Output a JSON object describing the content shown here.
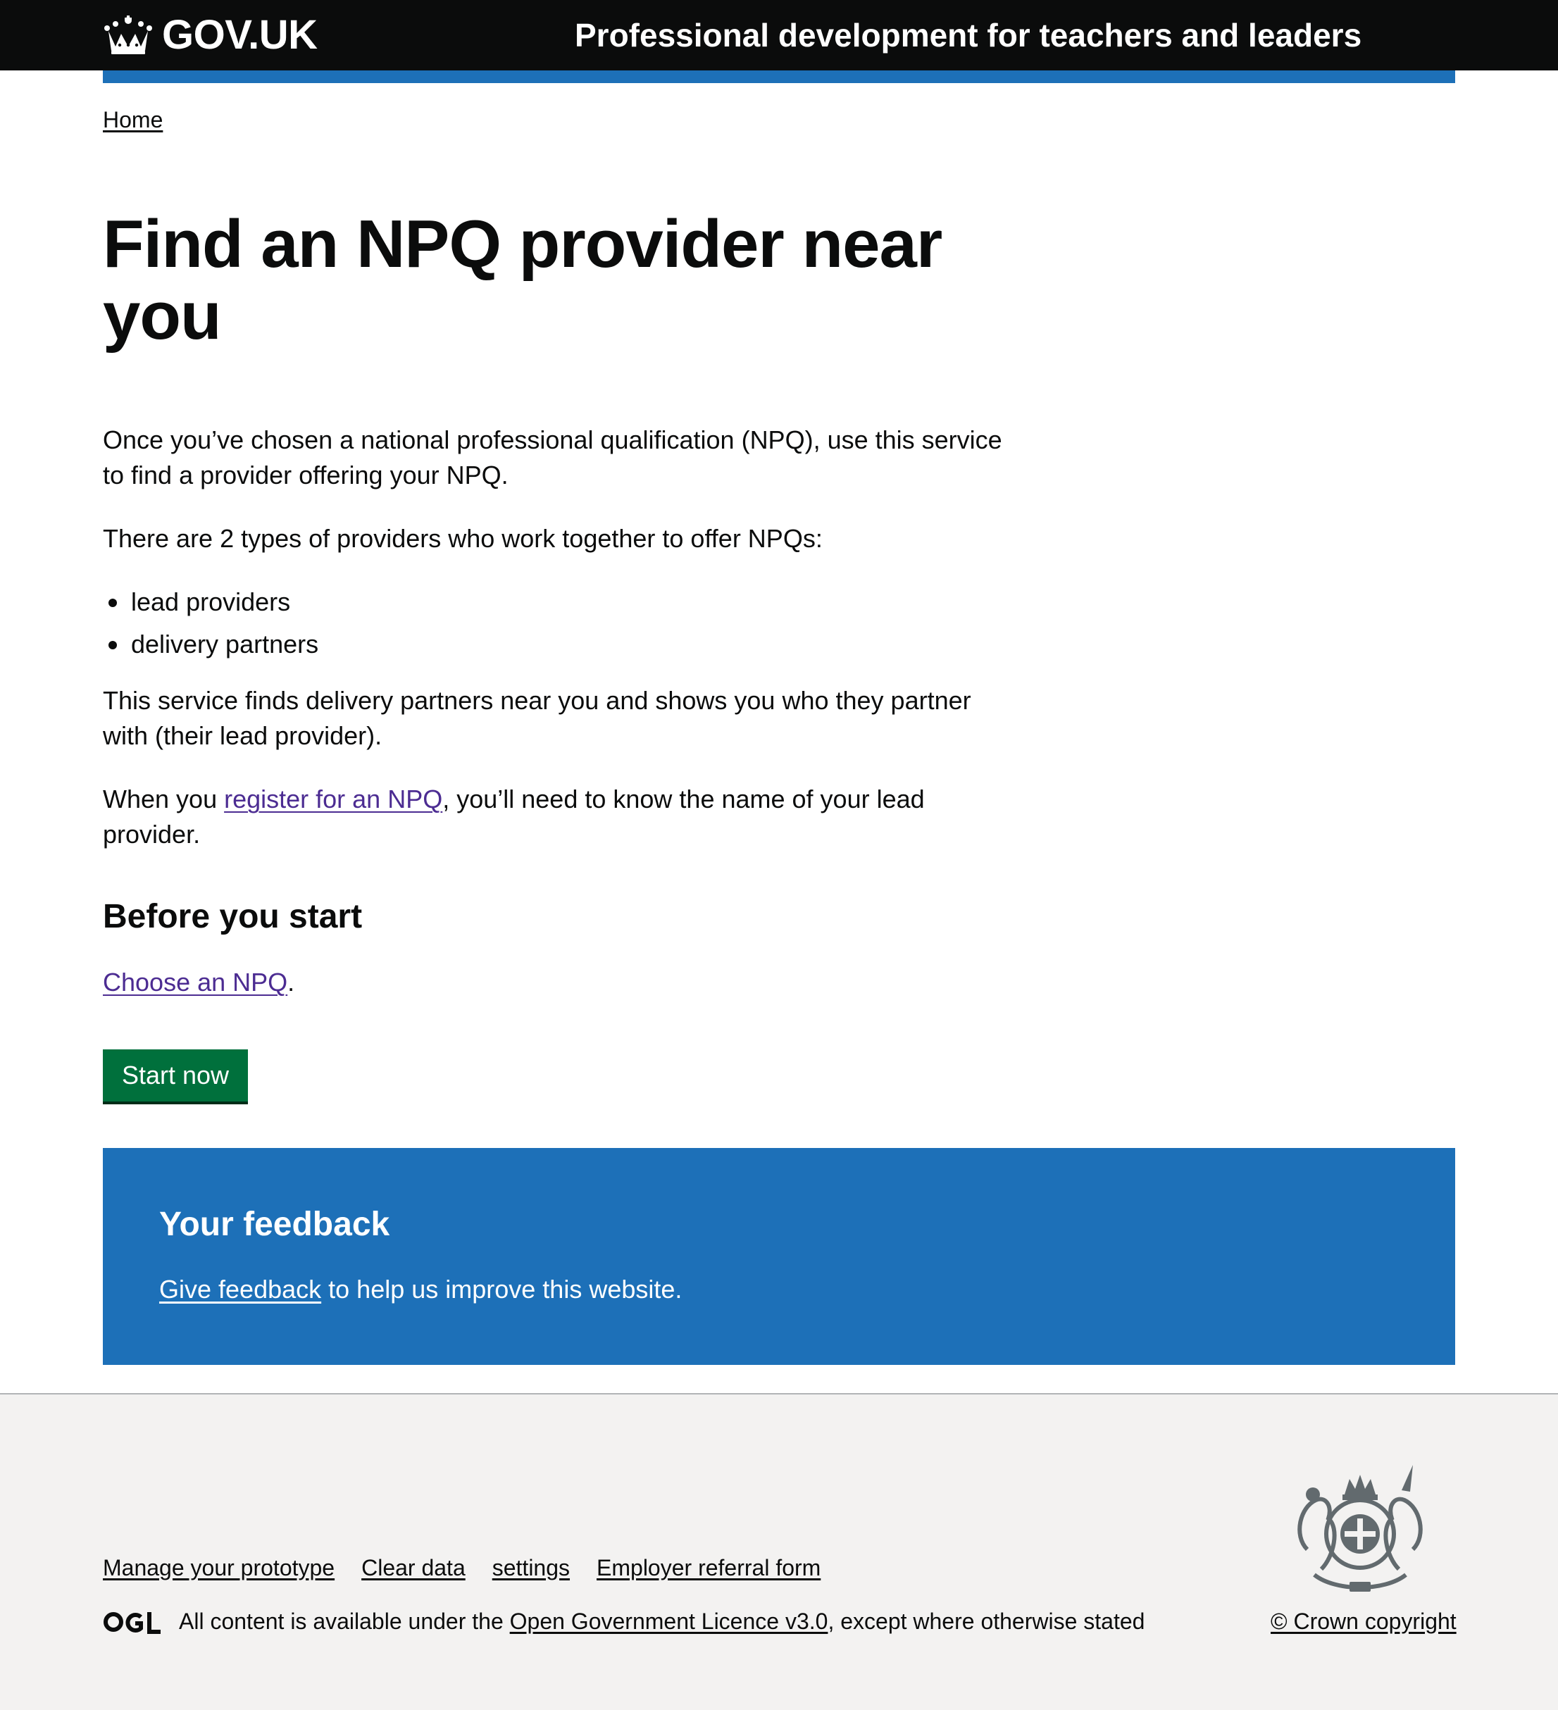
{
  "header": {
    "logo_text": "GOV.UK",
    "service_name": "Professional development for teachers and leaders"
  },
  "breadcrumb": {
    "home": "Home"
  },
  "main": {
    "title": "Find an NPQ provider near you",
    "intro": "Once you’ve chosen a national professional qualification (NPQ), use this service to find a provider offering your NPQ.",
    "types_intro": "There are 2 types of providers who work together to offer NPQs:",
    "provider_types": [
      "lead providers",
      "delivery partners"
    ],
    "finds_text": "This service finds delivery partners near you and shows you who they partner with (their lead provider).",
    "register_prefix": "When you ",
    "register_link": "register for an NPQ",
    "register_suffix": ", you’ll need to know the name of your lead provider.",
    "before_heading": "Before you start",
    "choose_link": "Choose an NPQ",
    "choose_suffix": ".",
    "start_button": "Start now"
  },
  "feedback": {
    "title": "Your feedback",
    "link": "Give feedback",
    "suffix": " to help us improve this website."
  },
  "footer": {
    "links": [
      "Manage your prototype",
      "Clear data",
      "settings",
      "Employer referral form"
    ],
    "licence_prefix": "All content is available under the ",
    "licence_link": "Open Government Licence v3.0",
    "licence_suffix": ", except where otherwise stated",
    "copyright": "© Crown copyright",
    "icons": {
      "logo": "crown-icon",
      "licence": "ogl-icon",
      "crest": "royal-crest-icon"
    }
  },
  "colors": {
    "header_bg": "#0b0c0c",
    "brand_blue": "#1d70b8",
    "button_green": "#00703c",
    "link_visited": "#4c2c92",
    "footer_bg": "#f3f2f1"
  }
}
